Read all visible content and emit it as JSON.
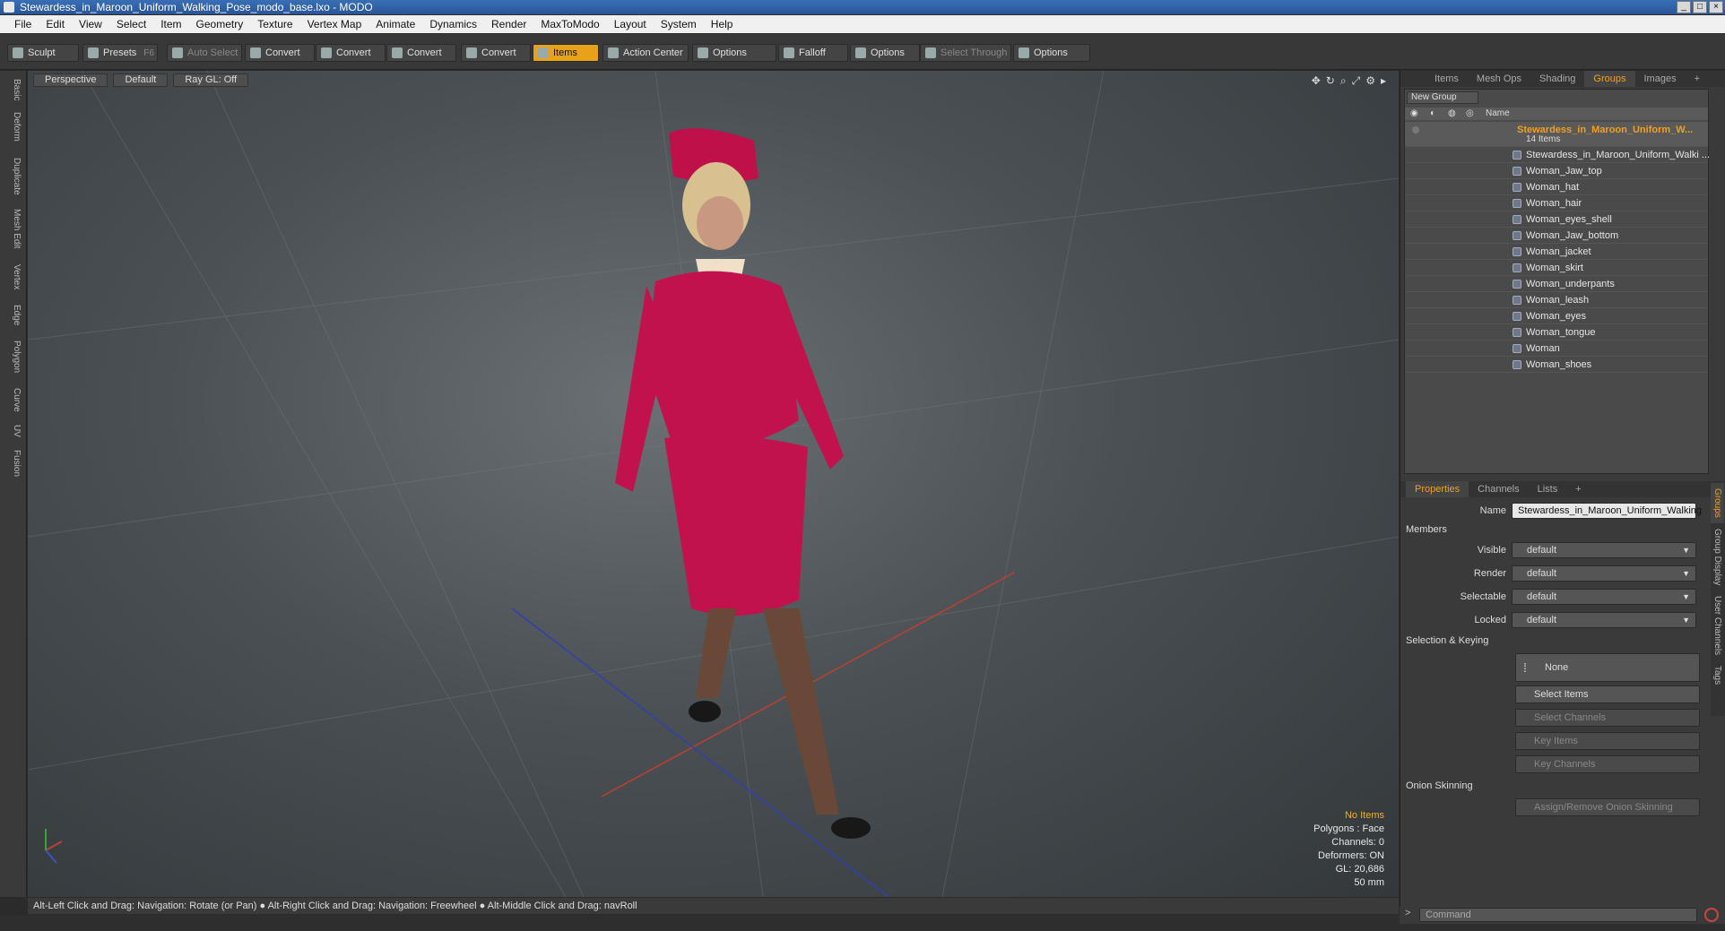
{
  "window": {
    "title": "Stewardess_in_Maroon_Uniform_Walking_Pose_modo_base.lxo - MODO"
  },
  "menu": [
    "File",
    "Edit",
    "View",
    "Select",
    "Item",
    "Geometry",
    "Texture",
    "Vertex Map",
    "Animate",
    "Dynamics",
    "Render",
    "MaxToModo",
    "Layout",
    "System",
    "Help"
  ],
  "toolbar": {
    "sculpt": "Sculpt",
    "presets": "Presets",
    "presets_key": "F6",
    "auto_select": "Auto Select",
    "convert1": "Convert",
    "convert2": "Convert",
    "convert3": "Convert",
    "convert4": "Convert",
    "items": "Items",
    "action_center": "Action Center",
    "options1": "Options",
    "falloff": "Falloff",
    "options2": "Options",
    "select_through": "Select Through",
    "options3": "Options"
  },
  "left_tabs": [
    "Basic",
    "Deform",
    "Duplicate",
    "Mesh Edit",
    "Vertex",
    "Edge",
    "Polygon",
    "Curve",
    "UV",
    "Fusion"
  ],
  "viewport": {
    "projection": "Perspective",
    "shading": "Default",
    "raygl": "Ray GL: Off",
    "hud": {
      "no_items": "No Items",
      "polygons": "Polygons : Face",
      "channels": "Channels: 0",
      "deformers": "Deformers: ON",
      "gl": "GL: 20,686",
      "unit": "50 mm"
    }
  },
  "status": "Alt-Left Click and Drag: Navigation: Rotate (or Pan) ● Alt-Right Click and Drag: Navigation: Freewheel ● Alt-Middle Click and Drag: navRoll",
  "right_tabs": [
    "Items",
    "Mesh Ops",
    "Shading",
    "Groups",
    "Images"
  ],
  "groups": {
    "new_group": "New Group",
    "col_name": "Name",
    "group_name": "Stewardess_in_Maroon_Uniform_W...",
    "group_count": "14 Items",
    "items": [
      "Stewardess_in_Maroon_Uniform_Walki ...",
      "Woman_Jaw_top",
      "Woman_hat",
      "Woman_hair",
      "Woman_eyes_shell",
      "Woman_Jaw_bottom",
      "Woman_jacket",
      "Woman_skirt",
      "Woman_underpants",
      "Woman_leash",
      "Woman_eyes",
      "Woman_tongue",
      "Woman",
      "Woman_shoes"
    ]
  },
  "prop_tabs": [
    "Properties",
    "Channels",
    "Lists"
  ],
  "properties": {
    "name_label": "Name",
    "name_value": "Stewardess_in_Maroon_Uniform_Walking",
    "members": "Members",
    "visible_label": "Visible",
    "visible_value": "default",
    "render_label": "Render",
    "render_value": "default",
    "selectable_label": "Selectable",
    "selectable_value": "default",
    "locked_label": "Locked",
    "locked_value": "default",
    "selection_keying": "Selection & Keying",
    "none": "None",
    "select_items": "Select Items",
    "select_channels": "Select Channels",
    "key_items": "Key Items",
    "key_channels": "Key Channels",
    "onion": "Onion Skinning",
    "assign_onion": "Assign/Remove Onion Skinning"
  },
  "side_tabs": [
    "Groups",
    "Group Display",
    "User Channels",
    "Tags"
  ],
  "command": {
    "placeholder": "Command"
  }
}
